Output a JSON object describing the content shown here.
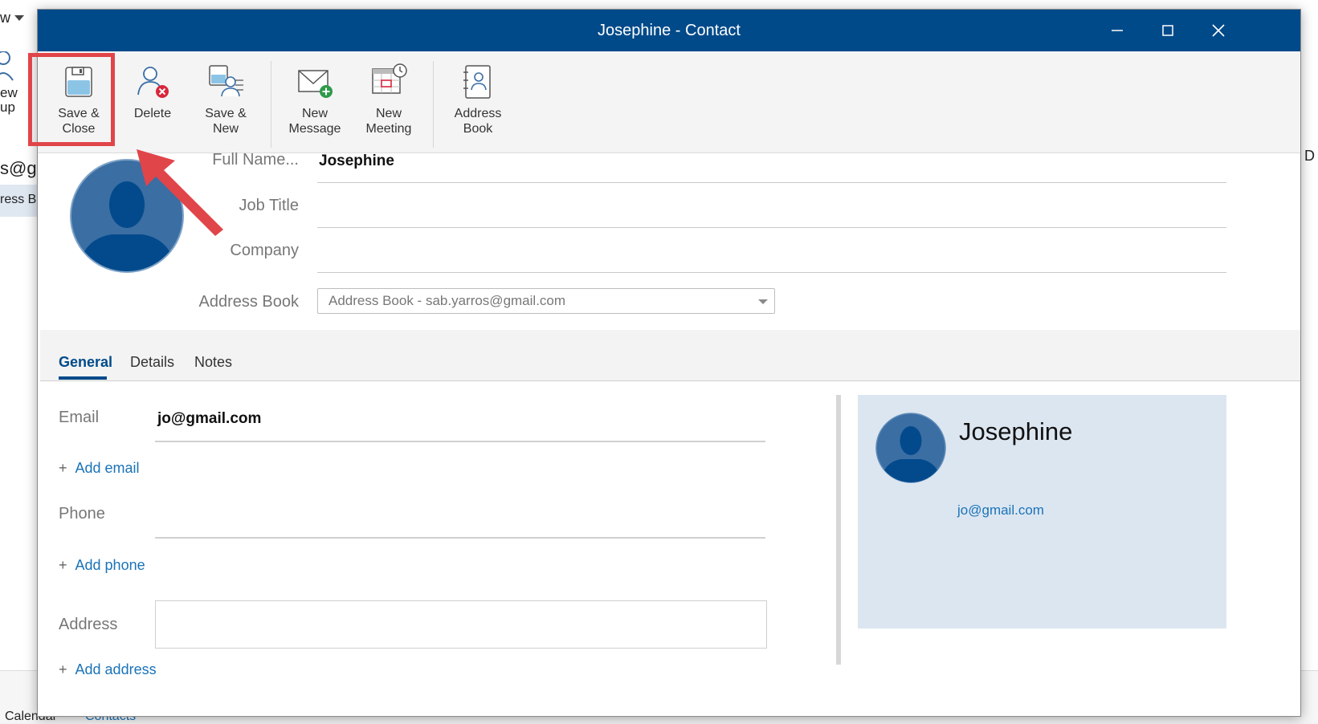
{
  "background": {
    "top_fragment": "w",
    "new_group_fragments": [
      "ew",
      "up"
    ],
    "email_fragment": "s@g",
    "address_fragment": "ress B",
    "right_fragment": "D",
    "bottom_left": "Calendar",
    "bottom_tab": "Contacts"
  },
  "window": {
    "title": "Josephine - Contact",
    "minimize": "—",
    "maximize": "☐",
    "close": "✕"
  },
  "ribbon": {
    "save_close": [
      "Save &",
      "Close"
    ],
    "delete": [
      "Delete"
    ],
    "save_new": [
      "Save &",
      "New"
    ],
    "new_message": [
      "New",
      "Message"
    ],
    "new_meeting": [
      "New",
      "Meeting"
    ],
    "address_book": [
      "Address",
      "Book"
    ]
  },
  "header": {
    "full_name_label": "Full Name...",
    "full_name_value": "Josephine",
    "job_title_label": "Job Title",
    "job_title_value": "",
    "company_label": "Company",
    "company_value": "",
    "address_book_label": "Address Book",
    "address_book_value": "Address Book - sab.yarros@gmail.com"
  },
  "tabs": [
    "General",
    "Details",
    "Notes"
  ],
  "general": {
    "email_label": "Email",
    "email_value": "jo@gmail.com",
    "add_email": "Add email",
    "phone_label": "Phone",
    "phone_value": "",
    "add_phone": "Add phone",
    "address_label": "Address",
    "add_address": "Add address"
  },
  "card": {
    "name": "Josephine",
    "email": "jo@gmail.com"
  },
  "colors": {
    "titlebar": "#004a8a",
    "accent": "#1a73b8",
    "highlight": "#e0454a",
    "card_bg": "#dce6f1"
  }
}
